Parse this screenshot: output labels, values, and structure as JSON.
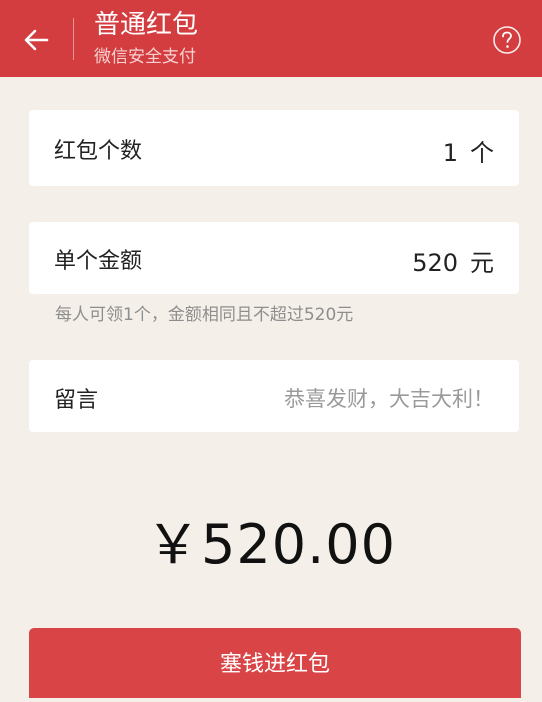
{
  "header": {
    "title": "普通红包",
    "subtitle": "微信安全支付"
  },
  "count_row": {
    "label": "红包个数",
    "value": "1",
    "unit": "个"
  },
  "amount_row": {
    "label": "单个金额",
    "value": "520",
    "unit": "元",
    "hint": "每人可领1个，金额相同且不超过520元"
  },
  "message_row": {
    "label": "留言",
    "placeholder": "恭喜发财，大吉大利！"
  },
  "total": {
    "display": "￥520.00"
  },
  "submit": {
    "label": "塞钱进红包"
  },
  "colors": {
    "header_red": "#d43d3f",
    "button_red": "#d94446",
    "background": "#f4efe8"
  },
  "icons": {
    "back": "back-arrow-icon",
    "help": "help-circle-icon"
  }
}
